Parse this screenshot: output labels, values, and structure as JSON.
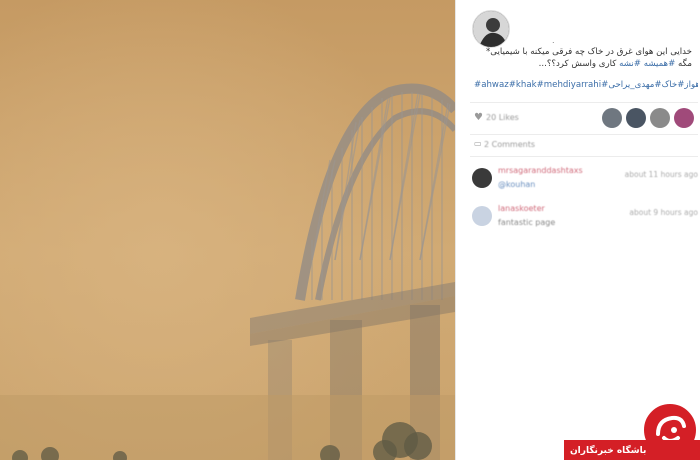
{
  "post": {
    "username": ".",
    "caption_line1": "خدایی این هوای غرق در خاک چه فرقی میکنه با شیمیایی*",
    "caption_line2_parts": [
      {
        "text": "مگه ",
        "tag": false
      },
      {
        "text": "#همیشه ",
        "tag": true
      },
      {
        "text": "#نشه",
        "tag": true
      },
      {
        "text": " کاری واسش کرد؟؟...",
        "tag": false
      }
    ],
    "hashtags": "#ahwaz#khak#mehdiyarrahi#اهواز#خاک#مهدی_یراحی",
    "likes": "20 Likes",
    "comments_count": "2 Comments"
  },
  "comments": [
    {
      "username": "mrsagaranddashtaxs",
      "text": "@kouhan",
      "time": "about 11 hours ago",
      "avatar_color": "#3a3a3a",
      "text_is_mention": true
    },
    {
      "username": "lanaskoeter",
      "text": "fantastic page",
      "time": "about 9 hours ago",
      "avatar_color": "#c9d3e2",
      "text_is_mention": false
    }
  ],
  "likers_colors": [
    "#6f7780",
    "#4a5563",
    "#8a8a8a",
    "#a04a7a"
  ],
  "logo": {
    "text": "باشگاه خبرنگاران",
    "color": "#d41f26"
  }
}
